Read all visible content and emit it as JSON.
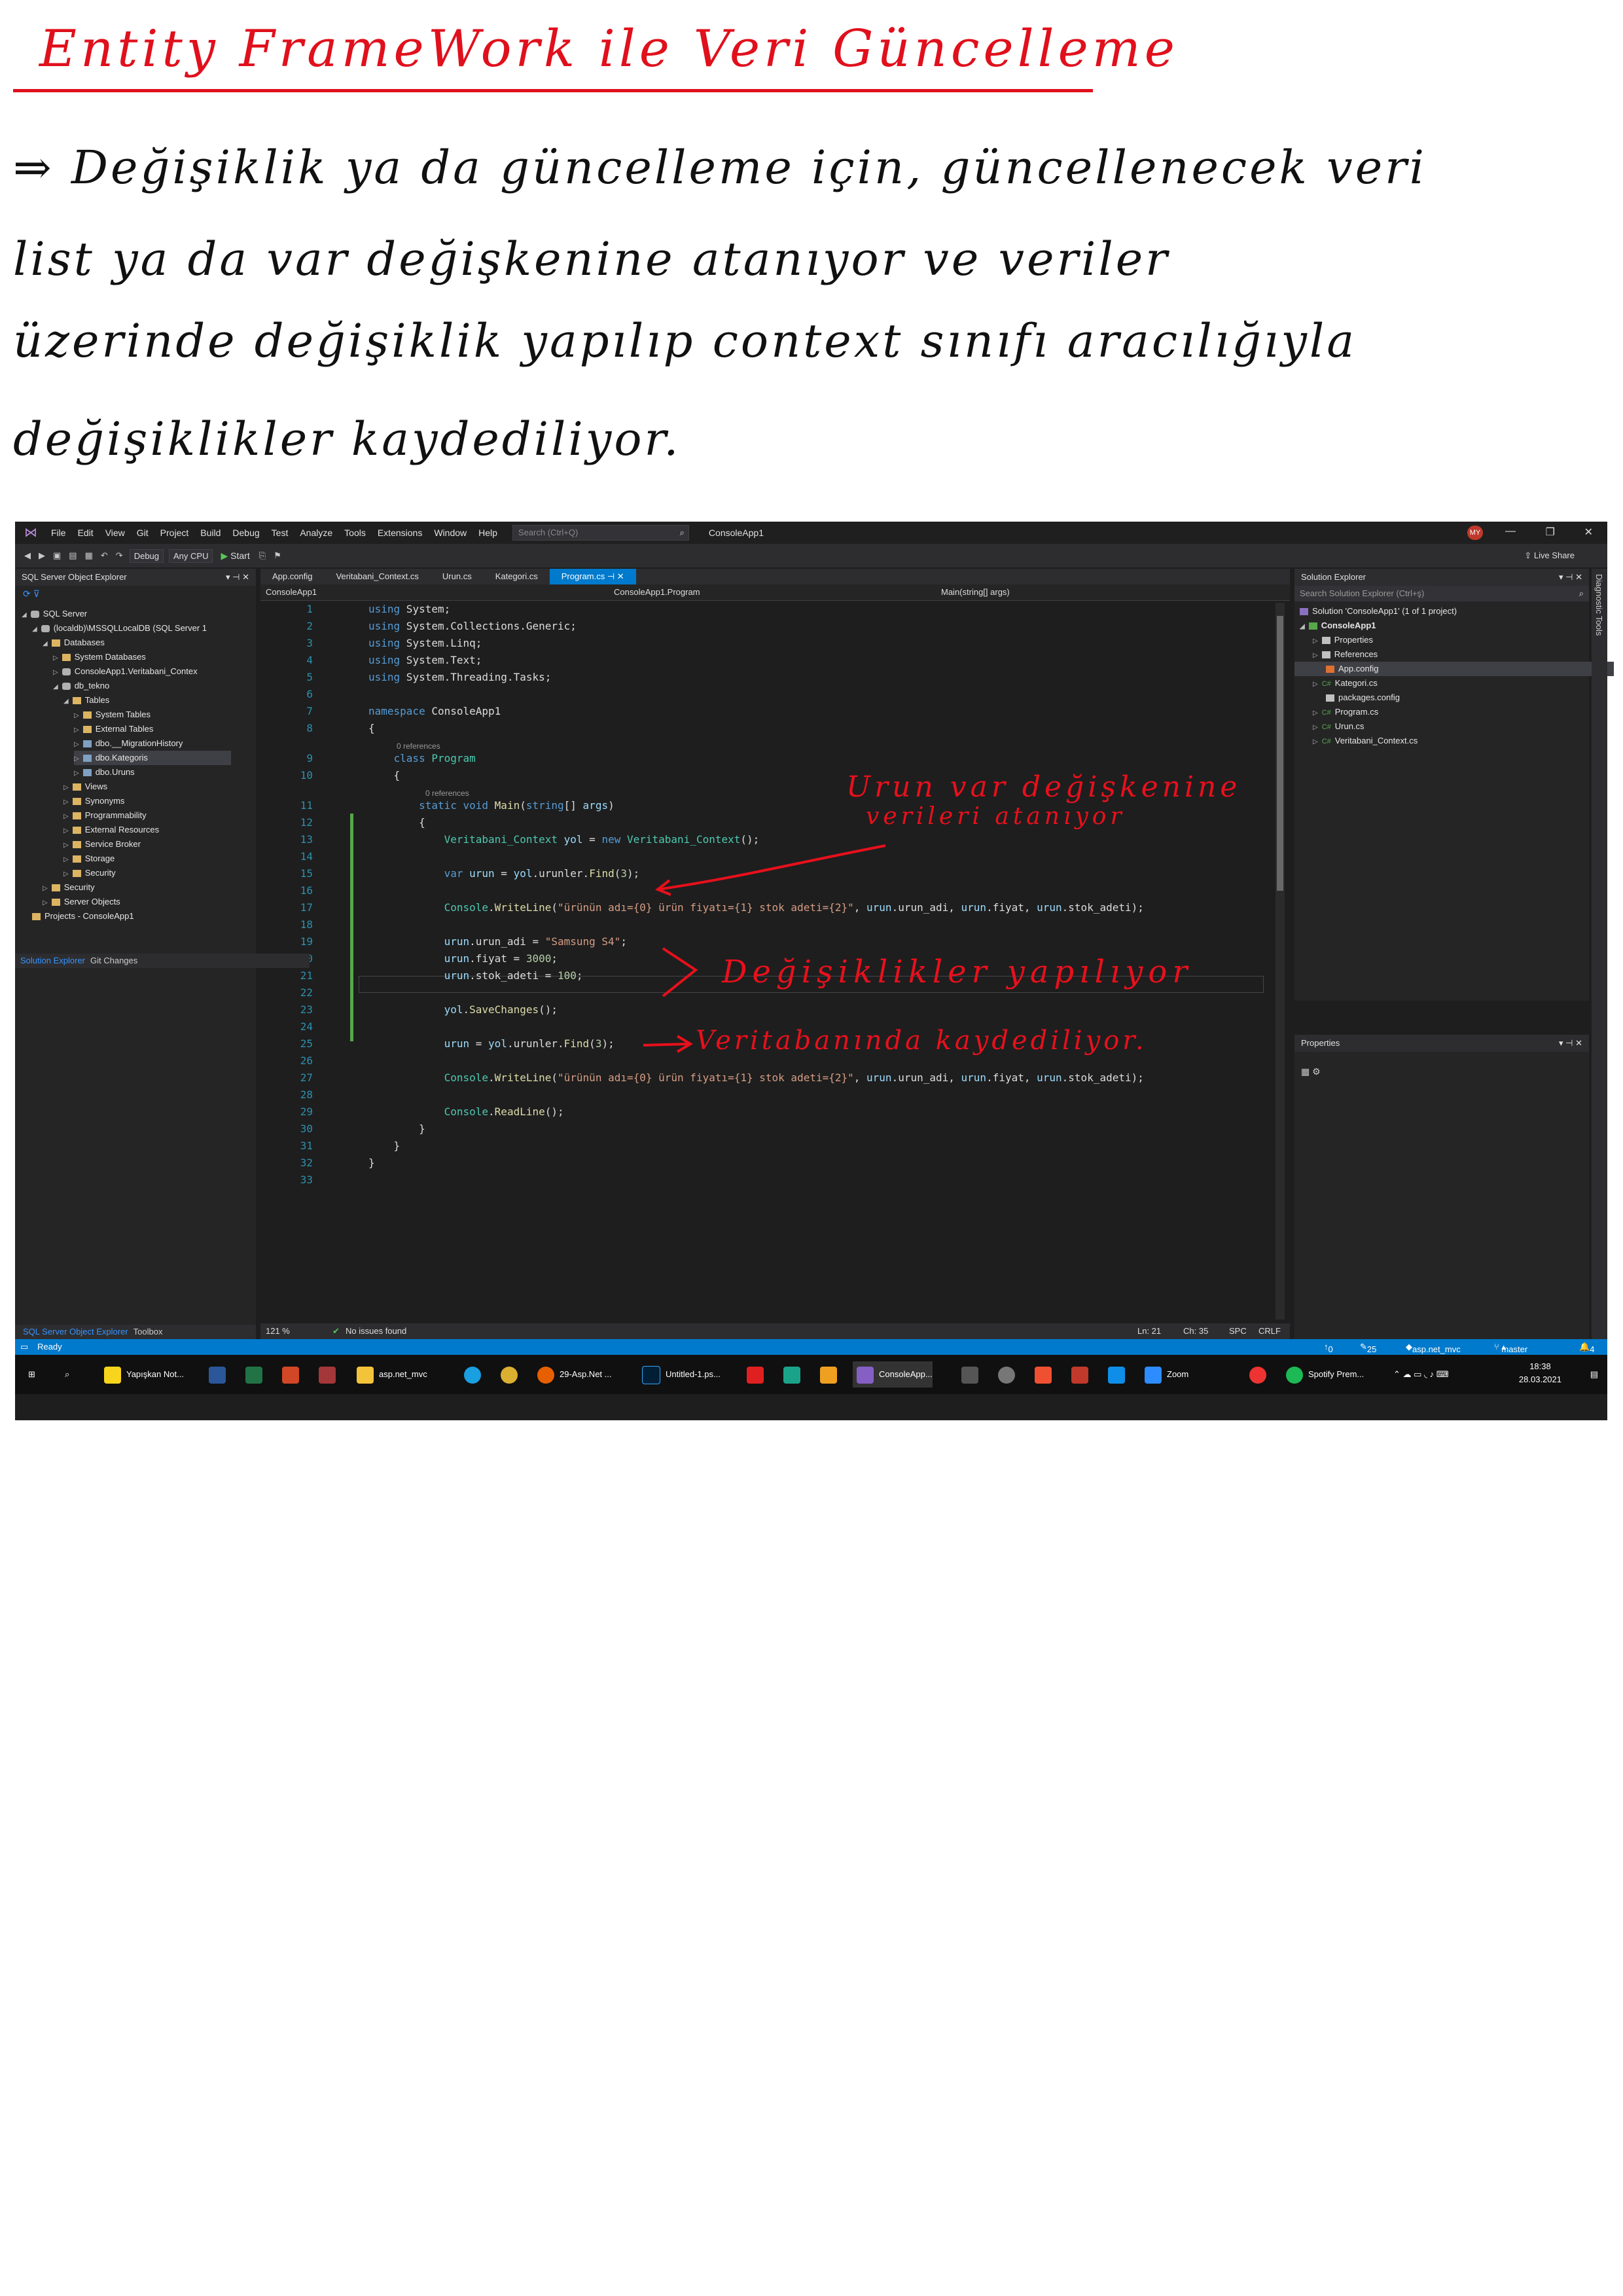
{
  "notes": {
    "title": "Entity FrameWork ile Veri Güncelleme",
    "line1": "⇒ Değişiklik ya da güncelleme için, güncellenecek veri",
    "line2": "list ya da var değişkenine atanıyor ve veriler",
    "line3": "üzerinde değişiklik yapılıp context sınıfı aracılığıyla",
    "line4": "değişiklikler kaydediliyor."
  },
  "annotations": {
    "a1_line1": "Urun var değişkenine",
    "a1_line2": "verileri atanıyor",
    "a2": "Değişiklikler yapılıyor",
    "a3": "Veritabanında kaydediliyor."
  },
  "ide": {
    "menu": [
      "File",
      "Edit",
      "View",
      "Git",
      "Project",
      "Build",
      "Debug",
      "Test",
      "Analyze",
      "Tools",
      "Extensions",
      "Window",
      "Help"
    ],
    "search_placeholder": "Search (Ctrl+Q)",
    "solution_name": "ConsoleApp1",
    "avatar": "MY",
    "toolbar": {
      "config": "Debug",
      "platform": "Any CPU",
      "start": "Start",
      "live_share": "Live Share"
    },
    "sso": {
      "title": "SQL Server Object Explorer",
      "tree": [
        "SQL Server",
        "(localdb)\\MSSQLLocalDB (SQL Server 1",
        "Databases",
        "System Databases",
        "ConsoleApp1.Veritabani_Contex",
        "db_tekno",
        "Tables",
        "System Tables",
        "External Tables",
        "dbo.__MigrationHistory",
        "dbo.Kategoris",
        "dbo.Uruns",
        "Views",
        "Synonyms",
        "Programmability",
        "External Resources",
        "Service Broker",
        "Storage",
        "Security",
        "Security",
        "Server Objects",
        "Projects - ConsoleApp1"
      ],
      "tab_active": "SQL Server Object Explorer",
      "tab_other": "Toolbox"
    },
    "tabs": [
      "App.config",
      "Veritabani_Context.cs",
      "Urun.cs",
      "Kategori.cs",
      "Program.cs"
    ],
    "nav": {
      "project": "ConsoleApp1",
      "class": "ConsoleApp1.Program",
      "member": "Main(string[] args)"
    },
    "refs": "0 references",
    "editor_status": {
      "zoom": "121 %",
      "issues": "No issues found",
      "ln": "Ln: 21",
      "ch": "Ch: 35",
      "spc": "SPC",
      "crlf": "CRLF"
    },
    "se": {
      "title": "Solution Explorer",
      "search": "Search Solution Explorer (Ctrl+ş)",
      "tree": [
        "Solution 'ConsoleApp1' (1 of 1 project)",
        "ConsoleApp1",
        "Properties",
        "References",
        "App.config",
        "Kategori.cs",
        "packages.config",
        "Program.cs",
        "Urun.cs",
        "Veritabani_Context.cs"
      ],
      "tab_active": "Solution Explorer",
      "tab_other": "Git Changes"
    },
    "props_title": "Properties",
    "diag": "Diagnostic Tools",
    "status": {
      "ready": "Ready",
      "up": "0",
      "pencil": "25",
      "repo": "asp.net_mvc",
      "branch": "master",
      "bell": "4"
    }
  },
  "taskbar": {
    "items": [
      "Yapışkan Not...",
      "asp.net_mvc",
      "29-Asp.Net ...",
      "Untitled-1.ps...",
      "ConsoleApp...",
      "Zoom",
      "Spotify Prem..."
    ],
    "time": "18:38",
    "date": "28.03.2021"
  }
}
